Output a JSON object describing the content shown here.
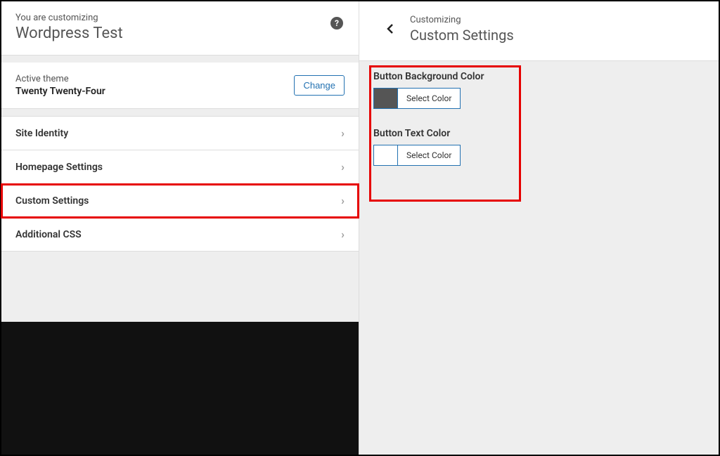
{
  "left": {
    "customizing_label": "You are customizing",
    "site_title": "Wordpress Test",
    "active_theme_label": "Active theme",
    "active_theme_name": "Twenty Twenty-Four",
    "change_button": "Change",
    "nav_items": [
      {
        "label": "Site Identity"
      },
      {
        "label": "Homepage Settings"
      },
      {
        "label": "Custom Settings"
      },
      {
        "label": "Additional CSS"
      }
    ]
  },
  "right": {
    "customizing_label": "Customizing",
    "section_title": "Custom Settings",
    "controls": [
      {
        "label": "Button Background Color",
        "button": "Select Color",
        "swatch": "#555555"
      },
      {
        "label": "Button Text Color",
        "button": "Select Color",
        "swatch": "#ffffff"
      }
    ]
  }
}
